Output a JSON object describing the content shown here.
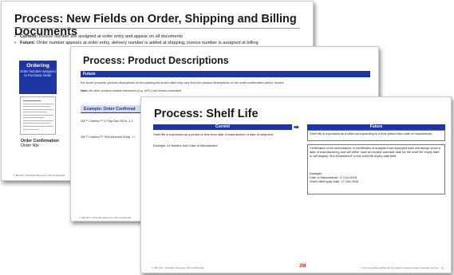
{
  "slide1": {
    "title": "Process: New Fields on Order, Shipping and Billing Documents",
    "bullet_current_label": "Current:",
    "bullet_current_text": " Invoice number are assigned at order entry and appear on all documents",
    "bullet_future_label": "Future:",
    "bullet_future_text": " Order number appears at order entry, delivery number is added at shipping, invoice number is assigned at billing",
    "ordering_title": "Ordering",
    "ordering_sub": "Order Number assigned to Purchase Order",
    "confirmation_title": "Order Confirmation",
    "confirmation_sub": "Order Nbr",
    "footer": "© 3M 2017. All Rights Reserved.   3M Confidential."
  },
  "slide2": {
    "title": "Process: Product Descriptions",
    "band": "Future",
    "paragraph": "For some products, product descriptions on the packing list and/or label may vary from the product descriptions on the order confirmation and/or invoice.",
    "note_label": "Note:",
    "note_text": " All other product-related references (e.g. UPC) will remain consistent.",
    "example_head": "Example: Order Confirmat",
    "example_row1": "3M™ Cubitron™ II Flap Disc 967A, 4-1",
    "example_row2": "3M™ Cubitron™ Self Adherent Wrap, 1 i",
    "footer": "© 3M 2017. All Rights Reserved.   3M Confidential."
  },
  "slide3": {
    "title": "Process: Shelf Life",
    "current_label": "Current",
    "future_label": "Future",
    "arrow_glyph": "➡",
    "current_text": "Shelf life is expressed as a period of time from date of manufacture or date of shipment.",
    "current_example": "Example: 24 Months from Date of Manufacture",
    "future_text": "Shelf life is expressed as a date corresponding to a time period from date of manufacture.",
    "future_detail": "Certificates of lot conformance or certificates of analysis from deployed sites will always show a date of manufacturing and will either have an explicit calendar date for the shelf life expiry date or will display “Not Determined” in the shelf life expiry date field.",
    "future_example_label": "Example",
    "future_example_line1": "Date of Manufacture: 17-Oct-2016",
    "future_example_line2": "Shelf Life/Expiry Date: 17-Oct-2018",
    "logo": "3M",
    "footer_left": "© 3M 2017. All Rights Reserved.   3M Confidential.",
    "footer_right": "If you would like additional information, please contact Customer Service.",
    "page_number": "11"
  }
}
